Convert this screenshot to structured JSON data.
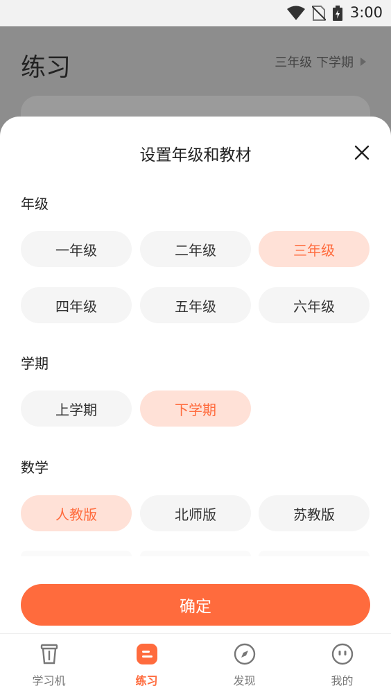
{
  "status_bar": {
    "time": "3:00"
  },
  "background_page": {
    "title": "练习",
    "grade_selector": "三年级 下学期"
  },
  "sheet": {
    "title": "设置年级和教材",
    "grade": {
      "label": "年级",
      "options": [
        "一年级",
        "二年级",
        "三年级",
        "四年级",
        "五年级",
        "六年级"
      ],
      "selected": "三年级"
    },
    "term": {
      "label": "学期",
      "options": [
        "上学期",
        "下学期"
      ],
      "selected": "下学期"
    },
    "math": {
      "label": "数学",
      "options": [
        "人教版",
        "北师版",
        "苏教版"
      ],
      "selected": "人教版"
    },
    "confirm_label": "确定"
  },
  "tabbar": {
    "items": [
      {
        "label": "学习机",
        "icon": "cup-icon"
      },
      {
        "label": "练习",
        "icon": "practice-icon"
      },
      {
        "label": "发现",
        "icon": "compass-icon"
      },
      {
        "label": "我的",
        "icon": "smiley-icon"
      }
    ],
    "active": "练习"
  },
  "colors": {
    "accent": "#ff6b3d",
    "selected_bg": "#ffe1d7",
    "chip_bg": "#f5f5f5"
  }
}
